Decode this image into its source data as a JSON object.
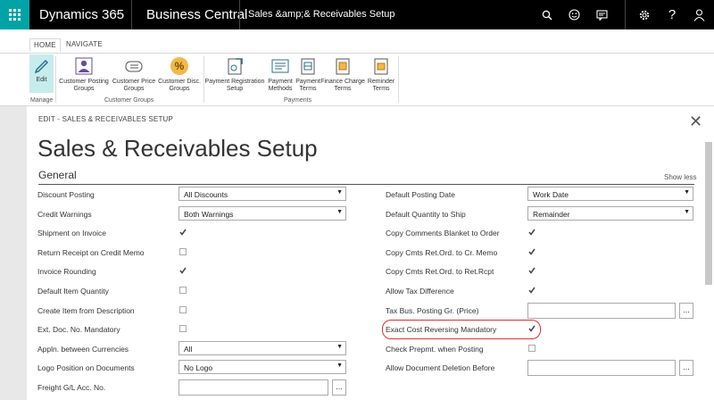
{
  "topbar": {
    "brand": "Dynamics 365",
    "product": "Business Central",
    "page": "Sales &amp;& Receivables Setup"
  },
  "ribbon": {
    "tabs": [
      "HOME",
      "NAVIGATE"
    ],
    "buttons": [
      {
        "label": "Edit"
      },
      {
        "label": "Customer Posting Groups"
      },
      {
        "label": "Customer Price Groups"
      },
      {
        "label": "Customer Disc. Groups"
      },
      {
        "label": "Payment Registration Setup"
      },
      {
        "label": "Payment Methods"
      },
      {
        "label": "Payment Terms"
      },
      {
        "label": "Finance Charge Terms"
      },
      {
        "label": "Reminder Terms"
      }
    ],
    "groups": [
      "Manage",
      "Customer Groups",
      "Payments"
    ]
  },
  "page": {
    "edit_title": "EDIT - SALES & RECEIVABLES SETUP",
    "title": "Sales & Receivables Setup",
    "section": "General",
    "show_less": "Show less"
  },
  "left_fields": [
    {
      "label": "Discount Posting",
      "type": "select",
      "value": "All Discounts"
    },
    {
      "label": "Credit Warnings",
      "type": "select",
      "value": "Both Warnings"
    },
    {
      "label": "Shipment on Invoice",
      "type": "check",
      "checked": true
    },
    {
      "label": "Return Receipt on Credit Memo",
      "type": "check",
      "checked": false
    },
    {
      "label": "Invoice Rounding",
      "type": "check",
      "checked": true
    },
    {
      "label": "Default Item Quantity",
      "type": "check",
      "checked": false
    },
    {
      "label": "Create Item from Description",
      "type": "check",
      "checked": false
    },
    {
      "label": "Ext. Doc. No. Mandatory",
      "type": "check",
      "checked": false
    },
    {
      "label": "Appln. between Currencies",
      "type": "select",
      "value": "All"
    },
    {
      "label": "Logo Position on Documents",
      "type": "select",
      "value": "No Logo"
    },
    {
      "label": "Freight G/L Acc. No.",
      "type": "lookup",
      "value": ""
    }
  ],
  "right_fields": [
    {
      "label": "Default Posting Date",
      "type": "select",
      "value": "Work Date"
    },
    {
      "label": "Default Quantity to Ship",
      "type": "select",
      "value": "Remainder"
    },
    {
      "label": "Copy Comments Blanket to Order",
      "type": "check",
      "checked": true
    },
    {
      "label": "Copy Cmts Ret.Ord. to Cr. Memo",
      "type": "check",
      "checked": true
    },
    {
      "label": "Copy Cmts Ret.Ord. to Ret.Rcpt",
      "type": "check",
      "checked": true
    },
    {
      "label": "Allow Tax Difference",
      "type": "check",
      "checked": true
    },
    {
      "label": "Tax Bus. Posting Gr. (Price)",
      "type": "lookup",
      "value": ""
    },
    {
      "label": "Exact Cost Reversing Mandatory",
      "type": "check",
      "checked": true
    },
    {
      "label": "Check Prepmt. when Posting",
      "type": "check",
      "checked": false
    },
    {
      "label": "Allow Document Deletion Before",
      "type": "lookup",
      "value": ""
    }
  ],
  "colors": {
    "accent": "#00a4a6",
    "highlight": "#d9302f",
    "edit_bg": "#c7ecec"
  }
}
